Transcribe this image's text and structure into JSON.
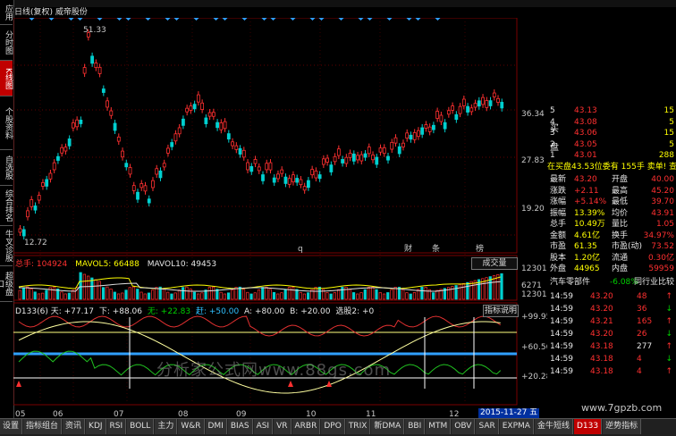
{
  "window": {
    "title": "日线(复权) 威帝股份",
    "code_tag": "D133"
  },
  "left_tabs": [
    {
      "label": "应用",
      "active": false
    },
    {
      "label": "分时图",
      "active": false
    },
    {
      "label": "K线图",
      "active": true
    },
    {
      "label": "个股资料",
      "active": false
    },
    {
      "label": "自选股",
      "active": false
    },
    {
      "label": "综合排名",
      "active": false
    },
    {
      "label": "牛叉诊股",
      "active": false
    },
    {
      "label": "超级盘口",
      "active": false
    }
  ],
  "main_chart": {
    "high_label": "51.33",
    "low_label": "12.72",
    "price_axis": [
      "36.34",
      "27.83",
      "19.20"
    ],
    "markers": [
      "q",
      "财",
      "条",
      "榜"
    ]
  },
  "volume_panel": {
    "total_label": "总手: 104924",
    "mavol5_label": "MAVOL5: 66488",
    "mavol10_label": "MAVOL10: 49453",
    "dropdown": "成交量",
    "axis": [
      "12301",
      "6271",
      "X10"
    ]
  },
  "indicator_panel": {
    "name": "D133(6)",
    "v1": "天: +77.17",
    "v2": "下: +88.06",
    "v3": "无: +22.83",
    "v4": "赶: +50.00",
    "v5": "A: +80.00",
    "v6": "B: +20.00",
    "v7": "选股2: +0",
    "button": "指标说明",
    "axis": [
      "+99.95",
      "+60.56",
      "+20.28"
    ]
  },
  "date_axis": [
    "05",
    "06",
    "07",
    "08",
    "09",
    "10",
    "11",
    "12"
  ],
  "date_badge": "2015-11-27 五",
  "order_book": {
    "sell": [
      {
        "lv": "5",
        "price": "43.13",
        "vol": "15"
      },
      {
        "lv": "4",
        "price": "43.08",
        "vol": "5"
      },
      {
        "lv": "3",
        "price": "43.06",
        "vol": "15"
      },
      {
        "lv": "2",
        "price": "43.05",
        "vol": "5"
      },
      {
        "lv": "1",
        "price": "43.01",
        "vol": "288"
      }
    ],
    "side_buy": "买",
    "side_pan": "盘",
    "inner": "在买盘43.53位委有",
    "inner2": "155手",
    "inner3": "卖单! 查看详情"
  },
  "quote": [
    {
      "k1": "最新",
      "v1": "43.20",
      "k2": "开盘",
      "v2": "40.00"
    },
    {
      "k1": "涨跌",
      "v1": "+2.11",
      "k2": "最高",
      "v2": "45.20"
    },
    {
      "k1": "涨幅",
      "v1": "+5.14%",
      "k2": "最低",
      "v2": "39.70"
    },
    {
      "k1": "振幅",
      "v1": "13.39%",
      "k2": "均价",
      "v2": "43.91"
    },
    {
      "k1": "总手",
      "v1": "10.49万",
      "k2": "量比",
      "v2": "1.05"
    },
    {
      "k1": "金额",
      "v1": "4.61亿",
      "k2": "换手",
      "v2": "34.97%"
    },
    {
      "k1": "市盈",
      "v1": "61.35",
      "k2": "市盈(动)",
      "v2": "73.52"
    },
    {
      "k1": "股本",
      "v1": "1.20亿",
      "k2": "流通",
      "v2": "0.30亿"
    },
    {
      "k1": "外盘",
      "v1": "44965",
      "k2": "内盘",
      "v2": "59959"
    }
  ],
  "sector": {
    "name": "汽车零部件",
    "change": "-6.08%",
    "compare": "同行业比较"
  },
  "trades": [
    {
      "time": "14:59",
      "price": "43.20",
      "vol": "48"
    },
    {
      "time": "14:59",
      "price": "43.20",
      "vol": "36"
    },
    {
      "time": "14:59",
      "price": "43.21",
      "vol": "165"
    },
    {
      "time": "14:59",
      "price": "43.20",
      "vol": "26"
    },
    {
      "time": "14:59",
      "price": "43.18",
      "vol": "277"
    },
    {
      "time": "14:59",
      "price": "43.18",
      "vol": "4"
    },
    {
      "time": "14:59",
      "price": "43.18",
      "vol": "4"
    }
  ],
  "bottom_tabs": [
    "设置",
    "指标组台",
    "资讯",
    "KDJ",
    "RSI",
    "BOLL",
    "主力",
    "W&R",
    "DMI",
    "BIAS",
    "ASI",
    "VR",
    "ARBR",
    "DPO",
    "TRIX",
    "新DMA",
    "BBI",
    "MTM",
    "OBV",
    "SAR",
    "EXPMA",
    "金牛短线",
    "D133",
    "逆势指标"
  ],
  "active_bottom_tab": "D133",
  "watermark": "分析家公式网www.88gs.com",
  "watermark_site": "www.7gpzb.com",
  "colors": {
    "up": "#ff3030",
    "down": "#00d0d0",
    "ma_yellow": "#ffff00",
    "ind_blue": "#30a0ff"
  }
}
